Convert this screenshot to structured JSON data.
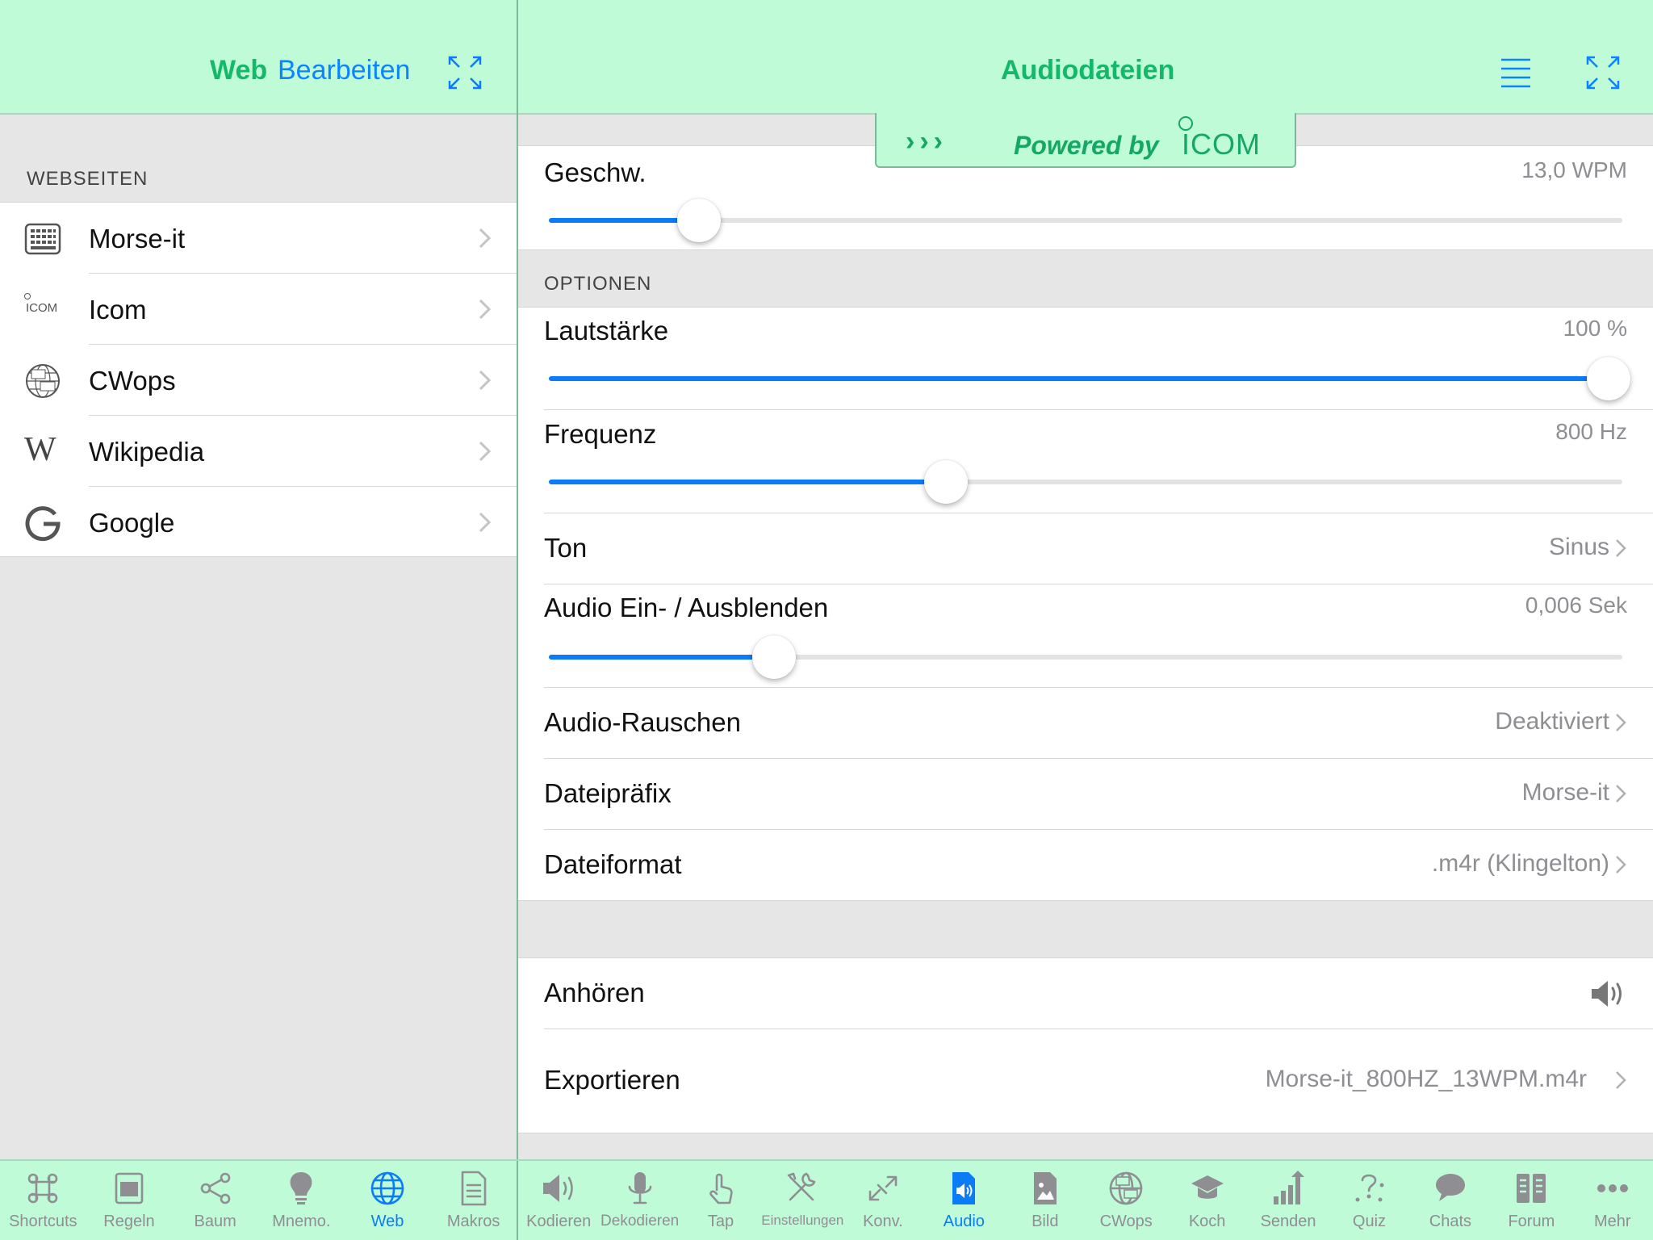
{
  "left": {
    "title": "Web",
    "edit_label": "Bearbeiten",
    "section_header": "WEBSEITEN",
    "sites": [
      {
        "label": "Morse-it",
        "icon": "keyboard-icon"
      },
      {
        "label": "Icom",
        "icon": "icom-logo-icon",
        "logo_text": "ICOM"
      },
      {
        "label": "CWops",
        "icon": "cwops-logo-icon"
      },
      {
        "label": "Wikipedia",
        "icon": "wikipedia-icon",
        "glyph": "W"
      },
      {
        "label": "Google",
        "icon": "google-icon"
      }
    ]
  },
  "right": {
    "title": "Audiodateien",
    "banner": {
      "arrows": "›››",
      "powered_by": "Powered by",
      "brand": "ICOM"
    },
    "speed": {
      "label": "Geschw.",
      "value": "13,0 WPM",
      "level": 0.14
    },
    "options_header": "OPTIONEN",
    "volume": {
      "label": "Lautstärke",
      "value": "100 %",
      "level": 1.0
    },
    "frequency": {
      "label": "Frequenz",
      "value": "800 Hz",
      "level": 0.37
    },
    "tone": {
      "label": "Ton",
      "value": "Sinus"
    },
    "fade": {
      "label": "Audio Ein- / Ausblenden",
      "value": "0,006 Sek",
      "level": 0.21
    },
    "noise": {
      "label": "Audio-Rauschen",
      "value": "Deaktiviert"
    },
    "prefix": {
      "label": "Dateipräfix",
      "value": "Morse-it"
    },
    "format": {
      "label": "Dateiformat",
      "value": ".m4r (Klingelton)"
    },
    "listen": {
      "label": "Anhören"
    },
    "export": {
      "label": "Exportieren",
      "value": "Morse-it_800HZ_13WPM.m4r"
    }
  },
  "tabs_left": [
    {
      "label": "Shortcuts",
      "icon": "command-icon",
      "active": false
    },
    {
      "label": "Regeln",
      "icon": "rules-icon",
      "active": false
    },
    {
      "label": "Baum",
      "icon": "tree-share-icon",
      "active": false
    },
    {
      "label": "Mnemo.",
      "icon": "lightbulb-icon",
      "active": false
    },
    {
      "label": "Web",
      "icon": "globe-icon",
      "active": true
    },
    {
      "label": "Makros",
      "icon": "document-icon",
      "active": false
    }
  ],
  "tabs_right": [
    {
      "label": "Kodieren",
      "icon": "speaker-icon",
      "active": false
    },
    {
      "label": "Dekodieren",
      "icon": "microphone-icon",
      "active": false
    },
    {
      "label": "Tap",
      "icon": "hand-tap-icon",
      "active": false
    },
    {
      "label": "Einstellungen",
      "icon": "tools-icon",
      "active": false
    },
    {
      "label": "Konv.",
      "icon": "convert-arrows-icon",
      "active": false
    },
    {
      "label": "Audio",
      "icon": "audio-file-icon",
      "active": true
    },
    {
      "label": "Bild",
      "icon": "image-file-icon",
      "active": false
    },
    {
      "label": "CWops",
      "icon": "cwops-icon",
      "active": false
    },
    {
      "label": "Koch",
      "icon": "graduation-cap-icon",
      "active": false
    },
    {
      "label": "Senden",
      "icon": "bar-chart-icon",
      "active": false
    },
    {
      "label": "Quiz",
      "icon": "quiz-icon",
      "active": false
    },
    {
      "label": "Chats",
      "icon": "chat-icon",
      "active": false
    },
    {
      "label": "Forum",
      "icon": "forum-icon",
      "active": false
    },
    {
      "label": "Mehr",
      "icon": "more-icon",
      "active": false
    }
  ],
  "colors": {
    "accent": "#0a7cf8",
    "bar": "#c0fbd8",
    "title_green": "#14b86a",
    "inactive": "#8e8e93"
  }
}
